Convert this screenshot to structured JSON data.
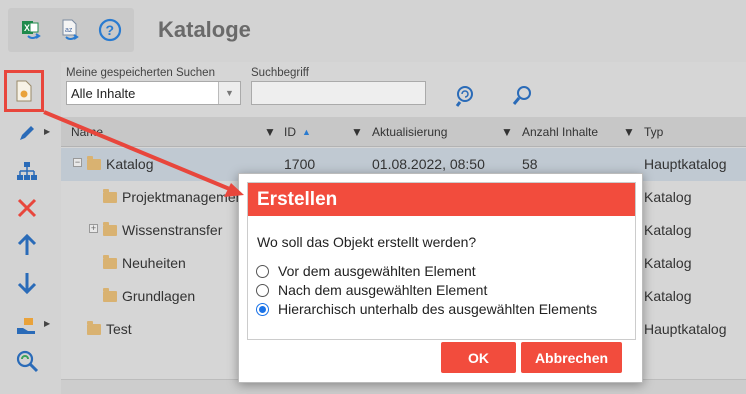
{
  "header": {
    "title": "Kataloge"
  },
  "toolbar": {
    "icons": [
      "excel-export-icon",
      "text-export-icon",
      "help-icon"
    ]
  },
  "leftbar": {
    "icons": [
      "new-document-icon",
      "edit-pencil-icon",
      "hierarchy-icon",
      "delete-x-icon",
      "move-up-icon",
      "move-down-icon",
      "hand-share-icon",
      "search-refresh-icon"
    ]
  },
  "search": {
    "saved_label": "Meine gespeicherten Suchen",
    "saved_value": "Alle Inhalte",
    "term_label": "Suchbegriff",
    "term_value": ""
  },
  "grid": {
    "columns": [
      "Name",
      "ID",
      "Aktualisierung",
      "Anzahl Inhalte",
      "Typ"
    ],
    "rows": [
      {
        "name": "Katalog",
        "id": "1700",
        "updated": "01.08.2022, 08:50",
        "count": "58",
        "type": "Hauptkatalog"
      },
      {
        "name": "Projektmanagement",
        "id": "",
        "updated": "",
        "count": "",
        "type": "Katalog"
      },
      {
        "name": "Wissenstransfer",
        "id": "",
        "updated": "",
        "count": "",
        "type": "Katalog"
      },
      {
        "name": "Neuheiten",
        "id": "",
        "updated": "",
        "count": "",
        "type": "Katalog"
      },
      {
        "name": "Grundlagen",
        "id": "",
        "updated": "",
        "count": "",
        "type": "Katalog"
      },
      {
        "name": "Test",
        "id": "",
        "updated": "",
        "count": "",
        "type": "Hauptkatalog"
      }
    ]
  },
  "dialog": {
    "title": "Erstellen",
    "question": "Wo soll das Objekt erstellt werden?",
    "options": [
      {
        "label": "Vor dem ausgewählten Element",
        "selected": false
      },
      {
        "label": "Nach dem ausgewählten Element",
        "selected": false
      },
      {
        "label": "Hierarchisch unterhalb des ausgewählten Elements",
        "selected": true
      }
    ],
    "ok": "OK",
    "cancel": "Abbrechen"
  },
  "colors": {
    "accent": "#f24c3d",
    "selected_radio": "#1a73e8",
    "selected_row": "#c0c9d2"
  }
}
